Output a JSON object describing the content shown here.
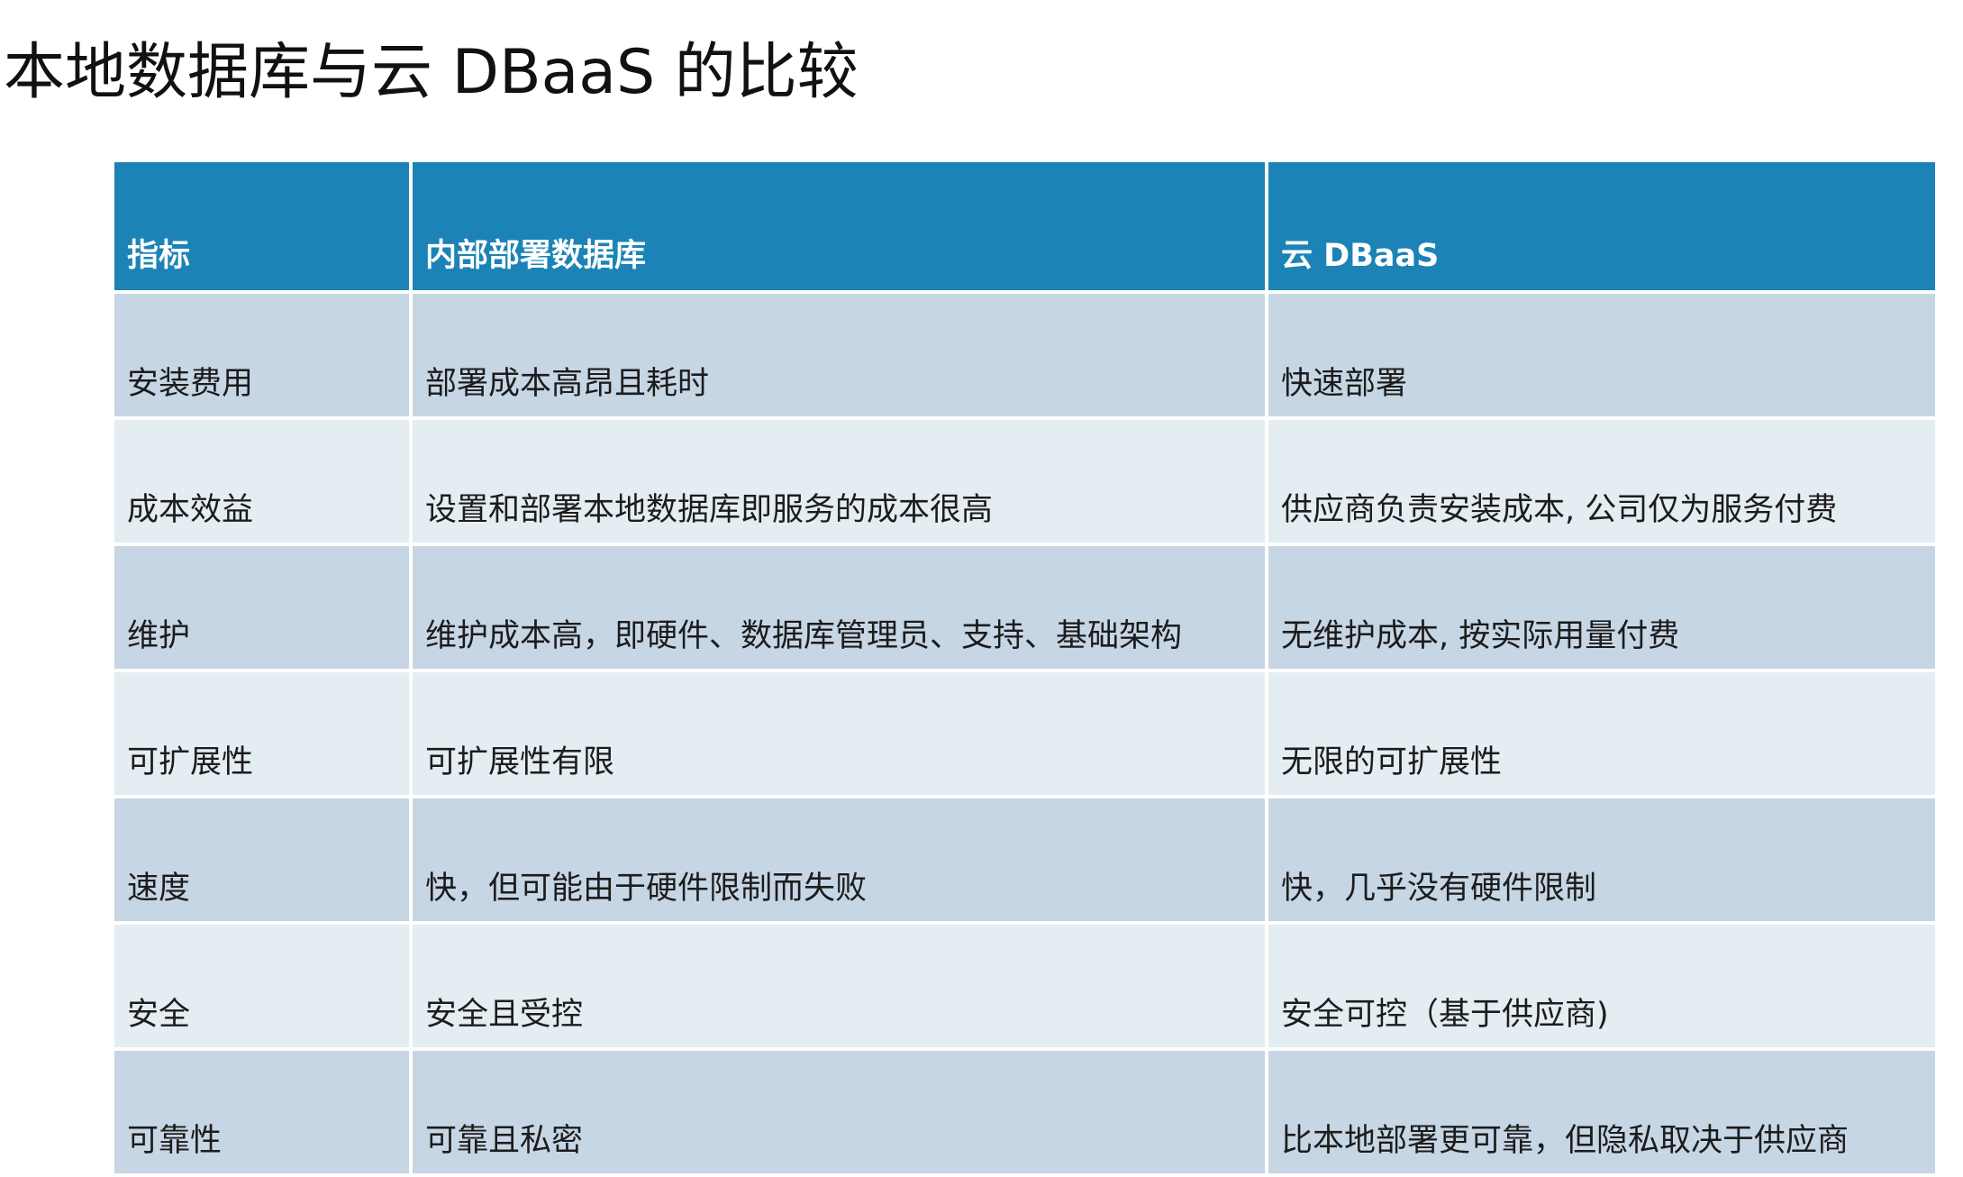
{
  "page": {
    "title": "本地数据库与云 DBaaS 的比较"
  },
  "table": {
    "headers": [
      "指标",
      "内部部署数据库",
      "云 DBaaS"
    ],
    "rows": [
      [
        "安装费用",
        "部署成本高昂且耗时",
        "快速部署"
      ],
      [
        "成本效益",
        "设置和部署本地数据库即服务的成本很高",
        "供应商负责安装成本, 公司仅为服务付费"
      ],
      [
        "维护",
        "维护成本高，即硬件、数据库管理员、支持、基础架构",
        "无维护成本, 按实际用量付费"
      ],
      [
        "可扩展性",
        "可扩展性有限",
        "无限的可扩展性"
      ],
      [
        "速度",
        "快，但可能由于硬件限制而失败",
        "快，几乎没有硬件限制"
      ],
      [
        "安全",
        "安全且受控",
        "安全可控（基于供应商)"
      ],
      [
        "可靠性",
        "可靠且私密",
        "比本地部署更可靠，但隐私取决于供应商"
      ]
    ]
  },
  "colors": {
    "header_bg": "#1c83b6",
    "header_text": "#ffffff",
    "row_odd": "#c7d6e5",
    "row_even": "#e4edf1"
  }
}
